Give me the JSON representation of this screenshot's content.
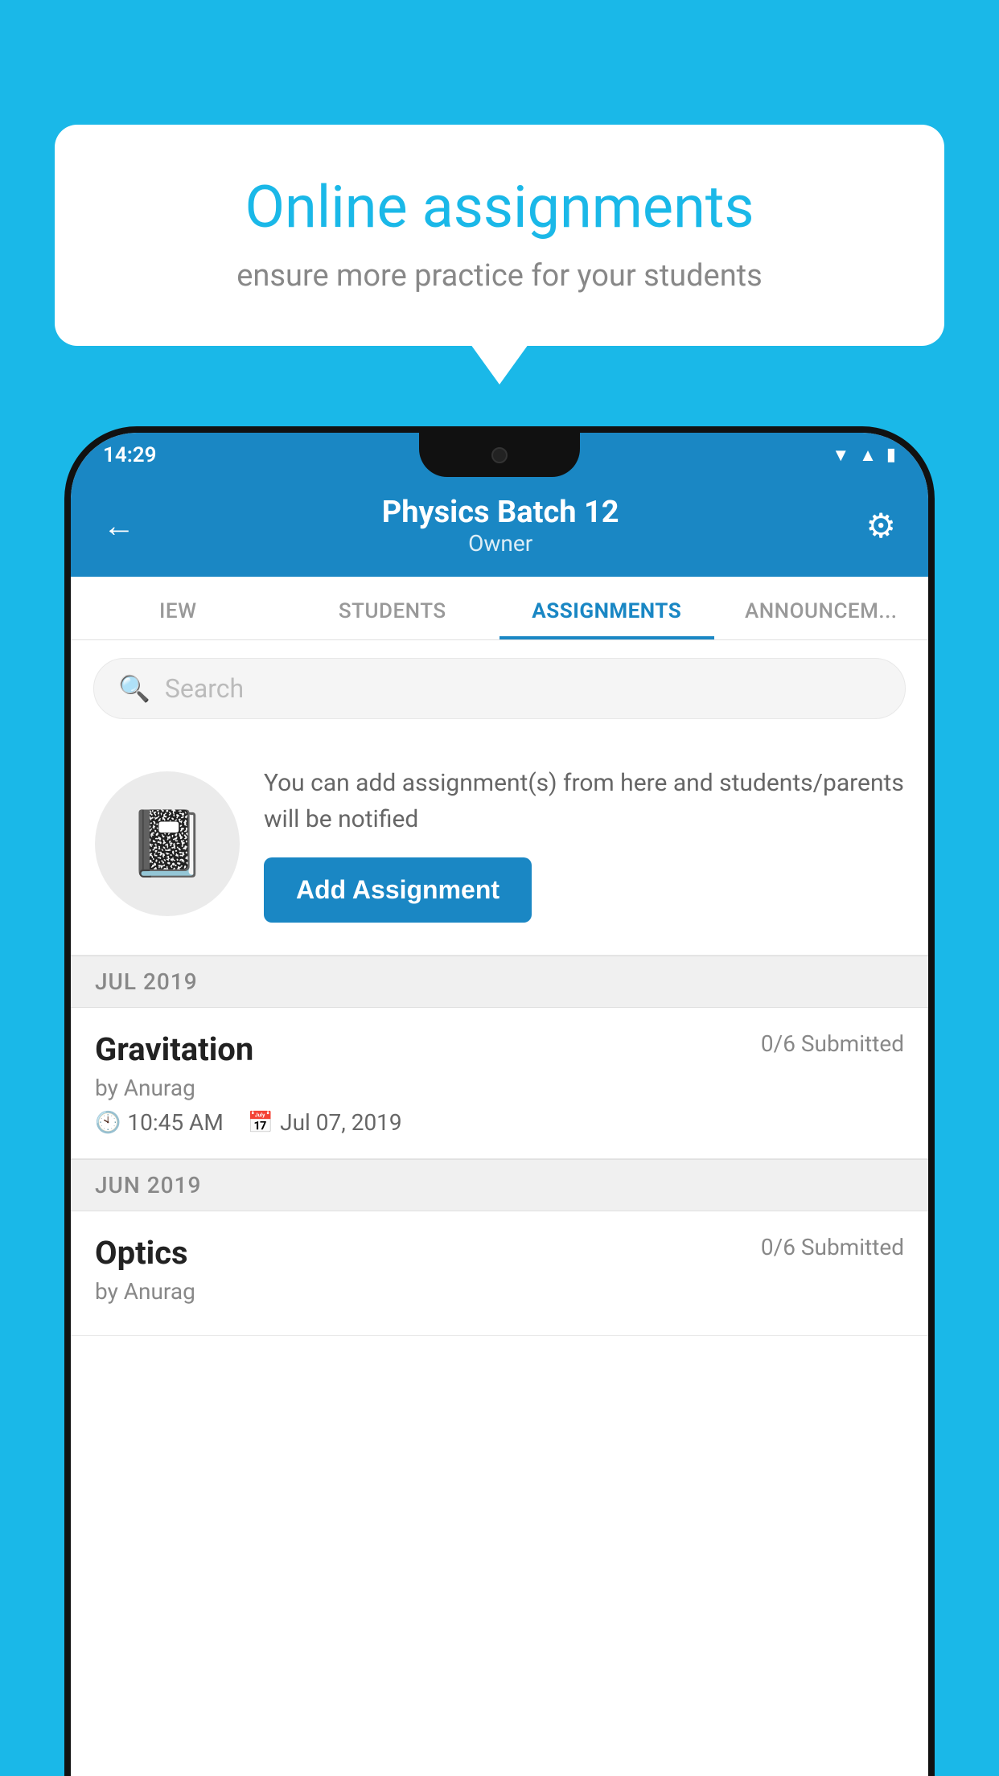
{
  "background_color": "#1ab8e8",
  "speech_bubble": {
    "title": "Online assignments",
    "subtitle": "ensure more practice for your students"
  },
  "status_bar": {
    "time": "14:29",
    "icons": [
      "wifi",
      "signal",
      "battery"
    ]
  },
  "header": {
    "title": "Physics Batch 12",
    "subtitle": "Owner",
    "back_label": "←",
    "gear_label": "⚙"
  },
  "tabs": [
    {
      "label": "IEW",
      "active": false
    },
    {
      "label": "STUDENTS",
      "active": false
    },
    {
      "label": "ASSIGNMENTS",
      "active": true
    },
    {
      "label": "ANNOUNCEMENTS",
      "active": false
    }
  ],
  "search": {
    "placeholder": "Search"
  },
  "promo": {
    "text": "You can add assignment(s) from here and students/parents will be notified",
    "button_label": "Add Assignment"
  },
  "sections": [
    {
      "month_label": "JUL 2019",
      "assignments": [
        {
          "title": "Gravitation",
          "submitted": "0/6 Submitted",
          "by": "by Anurag",
          "time": "10:45 AM",
          "date": "Jul 07, 2019"
        }
      ]
    },
    {
      "month_label": "JUN 2019",
      "assignments": [
        {
          "title": "Optics",
          "submitted": "0/6 Submitted",
          "by": "by Anurag",
          "time": "",
          "date": ""
        }
      ]
    }
  ]
}
